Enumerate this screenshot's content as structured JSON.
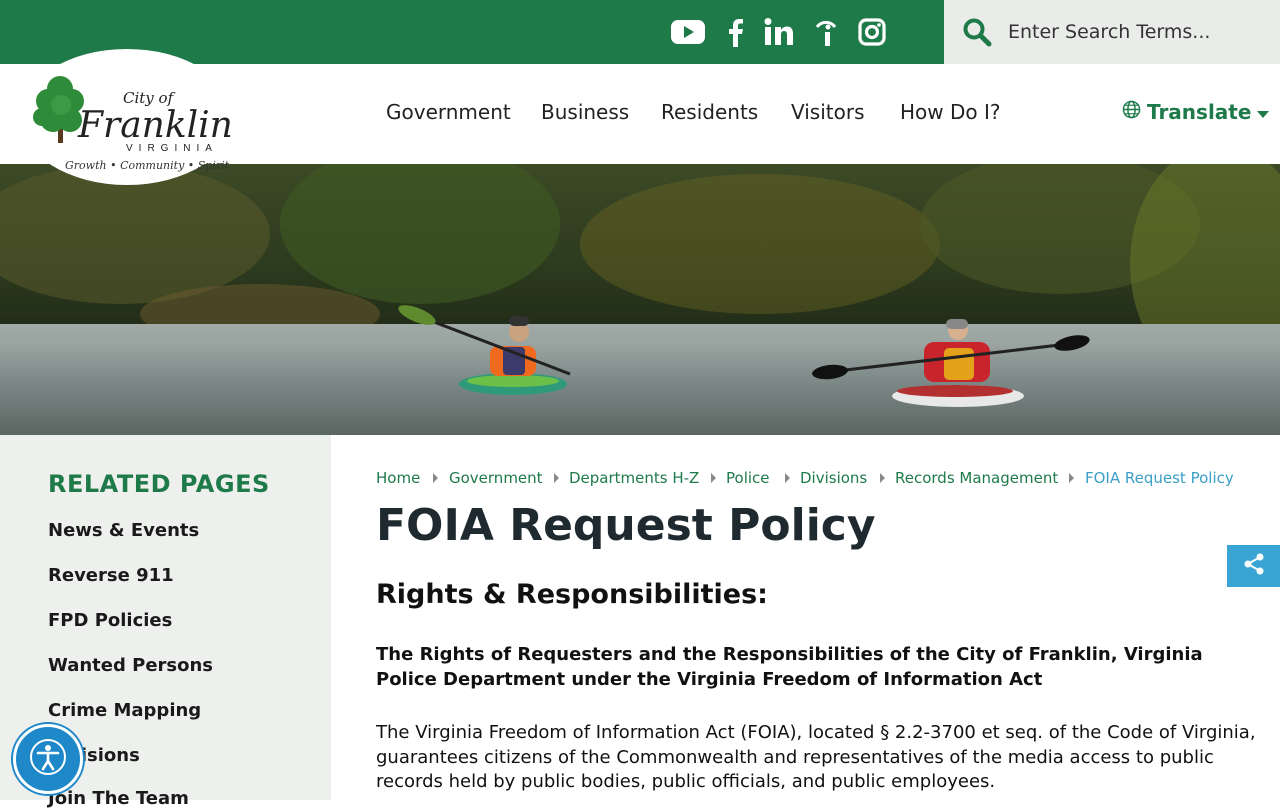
{
  "search": {
    "placeholder": "Enter Search Terms..."
  },
  "social": [
    "youtube-icon",
    "facebook-icon",
    "linkedin-icon",
    "info-icon",
    "instagram-icon"
  ],
  "logo": {
    "line1": "City of",
    "line2": "Franklin",
    "line3": "VIRGINIA",
    "tagline": "Growth • Community • Spirit"
  },
  "nav": {
    "items": [
      "Government",
      "Business",
      "Residents",
      "Visitors",
      "How Do I?"
    ],
    "translate": "Translate"
  },
  "sidebar": {
    "title": "RELATED PAGES",
    "items": [
      "News & Events",
      "Reverse 911",
      "FPD Policies",
      "Wanted Persons",
      "Crime Mapping",
      "Divisions",
      "Join The Team"
    ]
  },
  "breadcrumb": [
    "Home",
    "Government",
    "Departments H-Z",
    "Police",
    "Divisions",
    "Records Management",
    "FOIA Request Policy"
  ],
  "content": {
    "title": "FOIA Request Policy",
    "section": "Rights & Responsibilities:",
    "lead": "The Rights of Requesters and the Responsibilities of the City of Franklin, Virginia Police Department under the Virginia Freedom of Information Act",
    "body": " The Virginia Freedom of Information Act (FOIA), located § 2.2-3700 et seq. of the Code of Virginia, guarantees citizens of the Commonwealth and representatives of the media access to public records held by public bodies, public officials, and public employees."
  },
  "colors": {
    "brand_green": "#1f7a4a",
    "accent_blue": "#3aa4d4",
    "sidebar_bg": "#eef0ee"
  }
}
